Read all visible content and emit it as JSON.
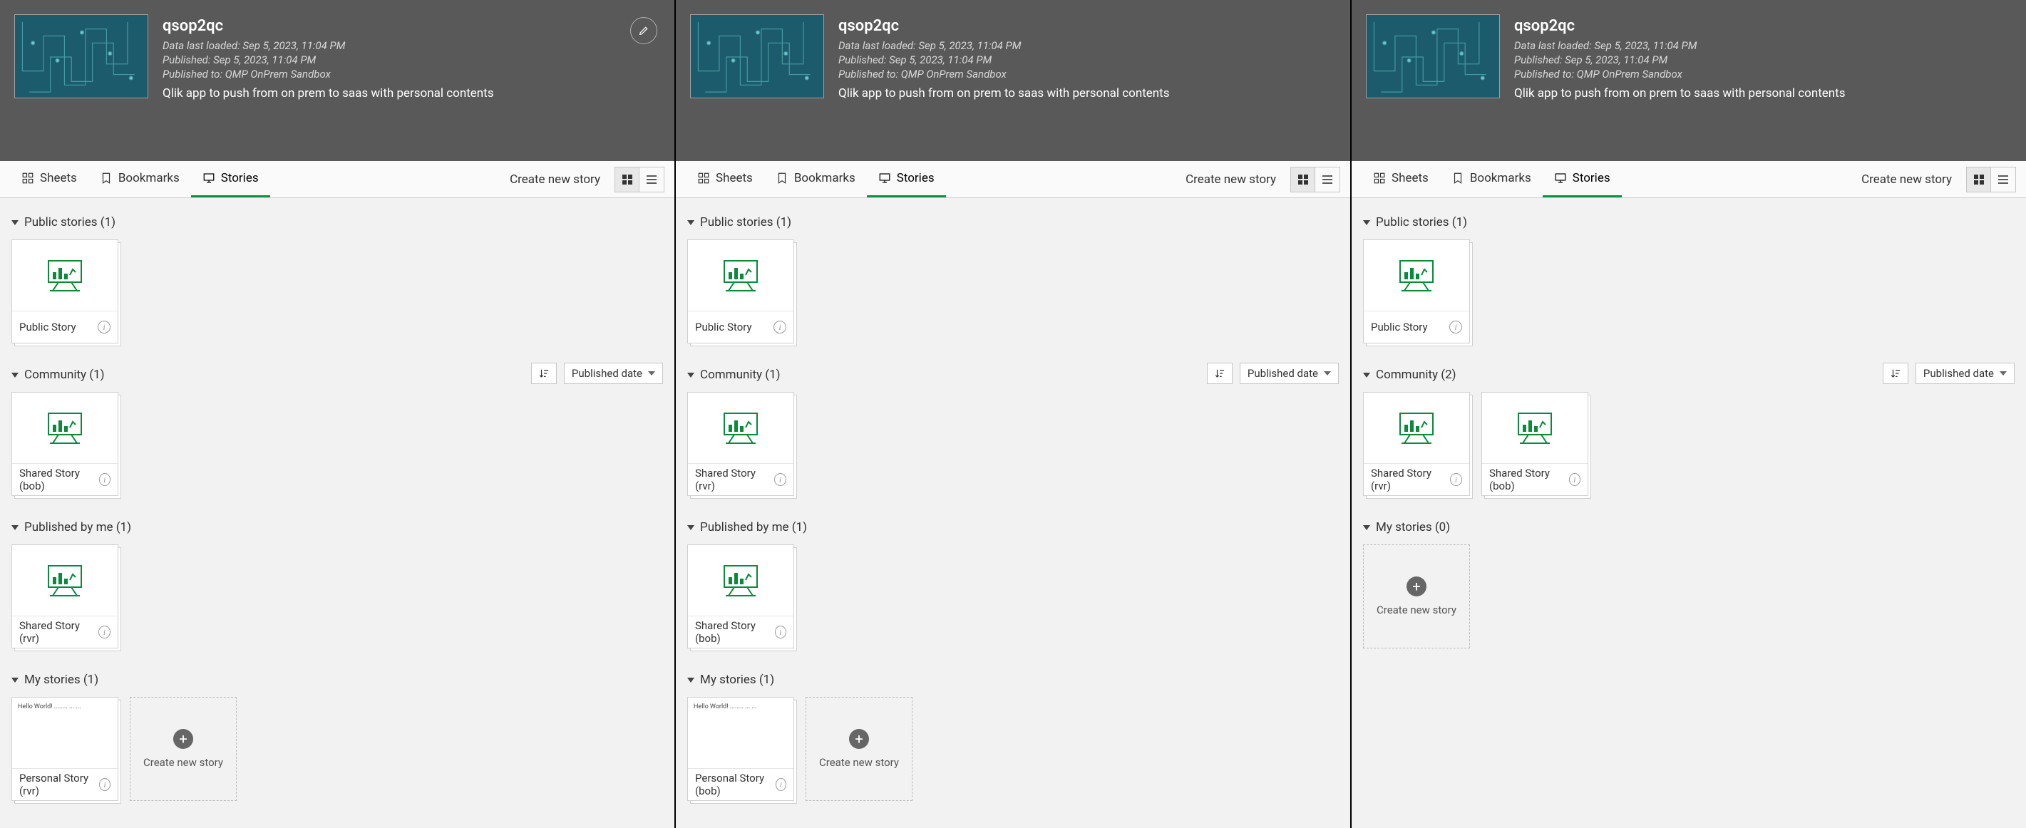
{
  "panels": [
    {
      "showEditBtn": true,
      "header": {
        "title": "qsop2qc",
        "meta1": "Data last loaded: Sep 5, 2023, 11:04 PM",
        "meta2": "Published: Sep 5, 2023, 11:04 PM",
        "meta3": "Published to: QMP OnPrem Sandbox",
        "desc": "Qlik app to push from on prem to saas with personal contents"
      },
      "tabs": {
        "sheets": "Sheets",
        "bookmarks": "Bookmarks",
        "stories": "Stories",
        "active": "stories"
      },
      "toolbar": {
        "createStory": "Create new story"
      },
      "sort": {
        "label": "Published date"
      },
      "sections": [
        {
          "title": "Public stories (1)",
          "controls": false,
          "items": [
            {
              "label": "Public Story",
              "thumb": "chart"
            }
          ]
        },
        {
          "title": "Community (1)",
          "controls": true,
          "items": [
            {
              "label": "Shared Story (bob)",
              "thumb": "chart"
            }
          ]
        },
        {
          "title": "Published by me (1)",
          "controls": false,
          "items": [
            {
              "label": "Shared Story (rvr)",
              "thumb": "chart"
            }
          ]
        },
        {
          "title": "My stories (1)",
          "controls": false,
          "items": [
            {
              "label": "Personal Story (rvr)",
              "thumb": "text"
            }
          ],
          "create": "Create new story"
        }
      ]
    },
    {
      "showEditBtn": false,
      "header": {
        "title": "qsop2qc",
        "meta1": "Data last loaded: Sep 5, 2023, 11:04 PM",
        "meta2": "Published: Sep 5, 2023, 11:04 PM",
        "meta3": "Published to: QMP OnPrem Sandbox",
        "desc": "Qlik app to push from on prem to saas with personal contents"
      },
      "tabs": {
        "sheets": "Sheets",
        "bookmarks": "Bookmarks",
        "stories": "Stories",
        "active": "stories"
      },
      "toolbar": {
        "createStory": "Create new story"
      },
      "sort": {
        "label": "Published date"
      },
      "sections": [
        {
          "title": "Public stories (1)",
          "controls": false,
          "items": [
            {
              "label": "Public Story",
              "thumb": "chart"
            }
          ]
        },
        {
          "title": "Community (1)",
          "controls": true,
          "items": [
            {
              "label": "Shared Story (rvr)",
              "thumb": "chart"
            }
          ]
        },
        {
          "title": "Published by me (1)",
          "controls": false,
          "items": [
            {
              "label": "Shared Story (bob)",
              "thumb": "chart"
            }
          ]
        },
        {
          "title": "My stories (1)",
          "controls": false,
          "items": [
            {
              "label": "Personal Story (bob)",
              "thumb": "text"
            }
          ],
          "create": "Create new story"
        }
      ]
    },
    {
      "showEditBtn": false,
      "header": {
        "title": "qsop2qc",
        "meta1": "Data last loaded: Sep 5, 2023, 11:04 PM",
        "meta2": "Published: Sep 5, 2023, 11:04 PM",
        "meta3": "Published to: QMP OnPrem Sandbox",
        "desc": "Qlik app to push from on prem to saas with personal contents"
      },
      "tabs": {
        "sheets": "Sheets",
        "bookmarks": "Bookmarks",
        "stories": "Stories",
        "active": "stories"
      },
      "toolbar": {
        "createStory": "Create new story"
      },
      "sort": {
        "label": "Published date"
      },
      "sections": [
        {
          "title": "Public stories (1)",
          "controls": false,
          "items": [
            {
              "label": "Public Story",
              "thumb": "chart"
            }
          ]
        },
        {
          "title": "Community (2)",
          "controls": true,
          "items": [
            {
              "label": "Shared Story (rvr)",
              "thumb": "chart"
            },
            {
              "label": "Shared Story (bob)",
              "thumb": "chart"
            }
          ]
        },
        {
          "title": "My stories (0)",
          "controls": false,
          "items": [],
          "create": "Create new story"
        }
      ]
    }
  ]
}
